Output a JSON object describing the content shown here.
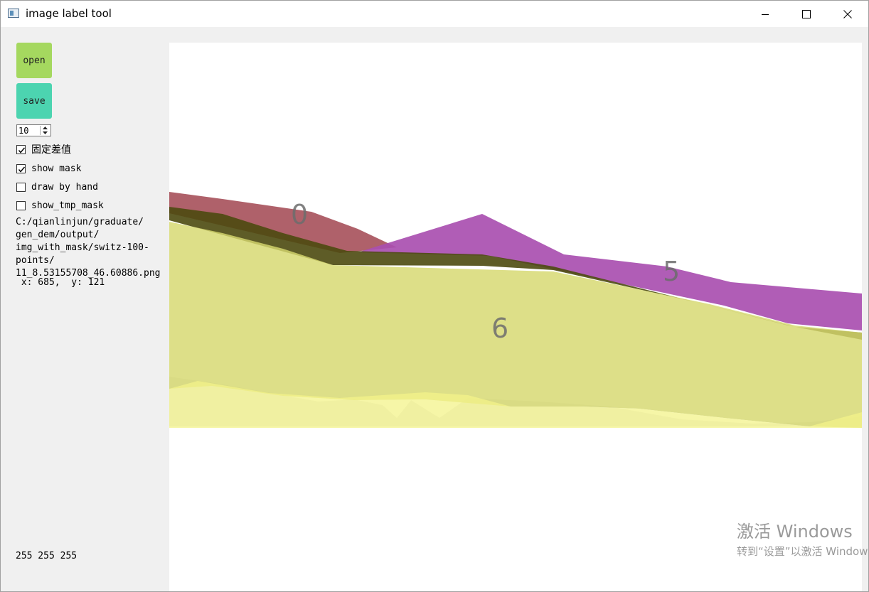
{
  "window": {
    "title": "image label tool"
  },
  "sidebar": {
    "open_label": "open",
    "save_label": "save",
    "spin_value": "10",
    "checkboxes": [
      {
        "label": "固定差值",
        "checked": true
      },
      {
        "label": "show mask",
        "checked": true
      },
      {
        "label": "draw by hand",
        "checked": false
      },
      {
        "label": "show_tmp_mask",
        "checked": false
      }
    ],
    "path": "C:/qianlinjun/graduate/\ngen_dem/output/\nimg_with_mask/switz-100-\npoints/\n11_8.53155708_46.60886.png",
    "coords": " x: 685,  y: 121",
    "rgb": "255 255 255"
  },
  "canvas": {
    "labels": [
      "0",
      "5",
      "6"
    ],
    "colors": {
      "mask0": "#a6505a",
      "mask5": "#a94fb0",
      "mask6": "#d4d77a",
      "shadow": "#4d4a10"
    }
  },
  "watermark": {
    "line1": "激活 Windows",
    "line2": "转到“设置”以激活 Windows。"
  }
}
